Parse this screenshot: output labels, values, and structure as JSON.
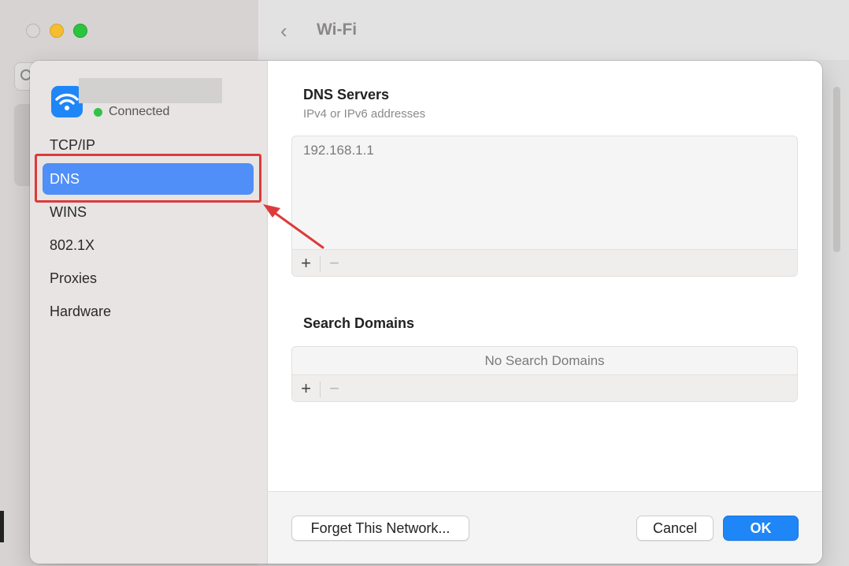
{
  "window": {
    "title": "Wi-Fi",
    "back_glyph": "‹"
  },
  "sidebar": {
    "network_status": "Connected",
    "items": [
      {
        "label": "TCP/IP"
      },
      {
        "label": "DNS",
        "selected": true
      },
      {
        "label": "WINS"
      },
      {
        "label": "802.1X"
      },
      {
        "label": "Proxies"
      },
      {
        "label": "Hardware"
      }
    ]
  },
  "dns": {
    "title": "DNS Servers",
    "subtitle": "IPv4 or IPv6 addresses",
    "servers": [
      "192.168.1.1"
    ],
    "add_label": "+",
    "remove_label": "−"
  },
  "search_domains": {
    "title": "Search Domains",
    "empty_text": "No Search Domains",
    "add_label": "+",
    "remove_label": "−"
  },
  "footer": {
    "forget_label": "Forget This Network...",
    "cancel_label": "Cancel",
    "ok_label": "OK"
  },
  "colors": {
    "accent": "#1f86f7",
    "selection": "#4f8ff7",
    "annotation": "#dc3b3b",
    "status_connected": "#33c14a"
  }
}
